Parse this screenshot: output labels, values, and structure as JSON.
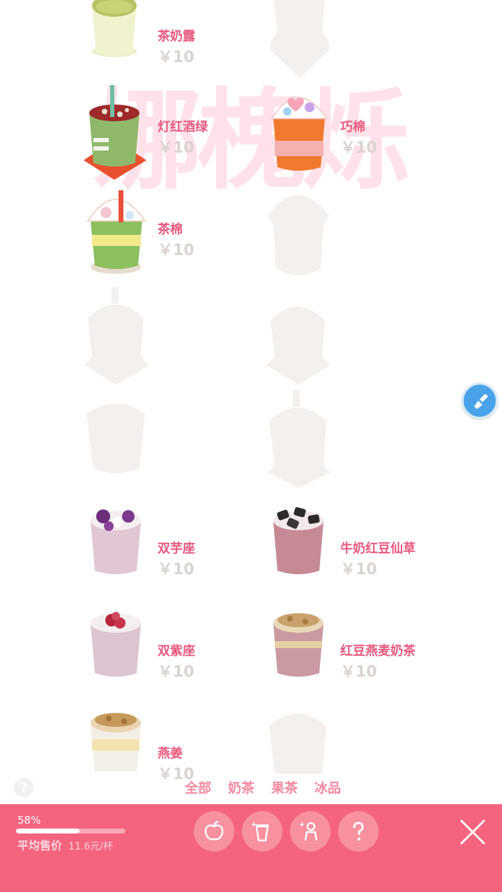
{
  "watermark": "娜槐烁",
  "drinks": [
    {
      "name": "茶奶露",
      "price": "￥10",
      "unlocked": true,
      "cup": "matcha-milk"
    },
    {
      "name": "",
      "price": "",
      "unlocked": false,
      "cup": "silhouette-bowl"
    },
    {
      "name": "灯红酒绿",
      "price": "￥10",
      "unlocked": true,
      "cup": "red-green-straw"
    },
    {
      "name": "巧棉",
      "price": "￥10",
      "unlocked": true,
      "cup": "heart-dome-orange"
    },
    {
      "name": "茶棉",
      "price": "￥10",
      "unlocked": true,
      "cup": "dome-green-straw"
    },
    {
      "name": "",
      "price": "",
      "unlocked": false,
      "cup": "silhouette-dome"
    },
    {
      "name": "",
      "price": "",
      "unlocked": false,
      "cup": "silhouette-straw"
    },
    {
      "name": "",
      "price": "",
      "unlocked": false,
      "cup": "silhouette-round"
    },
    {
      "name": "",
      "price": "",
      "unlocked": false,
      "cup": "silhouette-plain"
    },
    {
      "name": "",
      "price": "",
      "unlocked": false,
      "cup": "silhouette-straw-tall"
    },
    {
      "name": "双芋座",
      "price": "￥10",
      "unlocked": true,
      "cup": "purple-taro"
    },
    {
      "name": "牛奶红豆仙草",
      "price": "￥10",
      "unlocked": true,
      "cup": "grass-jelly"
    },
    {
      "name": "双紫座",
      "price": "￥10",
      "unlocked": true,
      "cup": "purple-bean"
    },
    {
      "name": "红豆燕麦奶茶",
      "price": "￥10",
      "unlocked": true,
      "cup": "oat-redbean"
    },
    {
      "name": "燕姜",
      "price": "￥10",
      "unlocked": true,
      "cup": "oat-ginger"
    },
    {
      "name": "",
      "price": "",
      "unlocked": false,
      "cup": "silhouette-plain"
    }
  ],
  "help_small": "?",
  "tabs": [
    "全部",
    "奶茶",
    "果茶",
    "冰品"
  ],
  "bottom": {
    "percent_text": "58%",
    "progress": 0.58,
    "avg_label": "平均售价",
    "avg_value": "11.6元/杯"
  },
  "icons": [
    "apple-icon",
    "cup-sparkle-icon",
    "person-sparkle-icon",
    "question-icon",
    "close-icon",
    "brush-icon"
  ],
  "colors": {
    "accent": "#f4647f",
    "name": "#e8587e",
    "price": "#d9d3d0",
    "tab": "#f2899f",
    "fab": "#4aa3e8"
  }
}
